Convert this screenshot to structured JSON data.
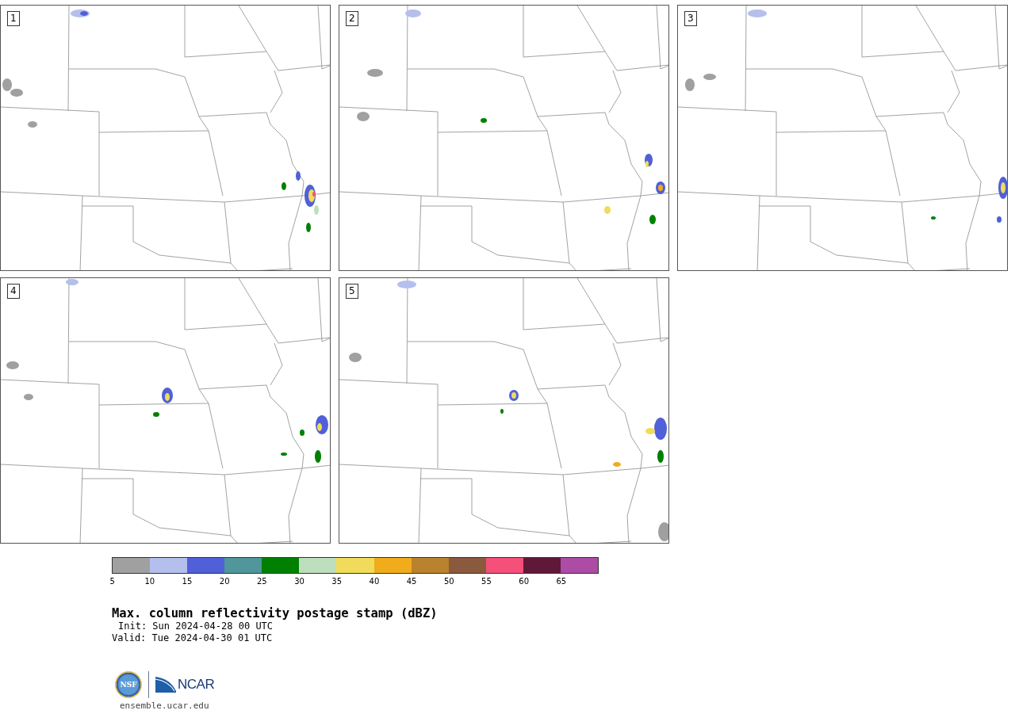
{
  "panels": [
    {
      "label": "1"
    },
    {
      "label": "2"
    },
    {
      "label": "3"
    },
    {
      "label": "4"
    },
    {
      "label": "5"
    }
  ],
  "colorbar": {
    "bins": [
      {
        "color": "#a0a0a0"
      },
      {
        "color": "#b4bfee"
      },
      {
        "color": "#5060d8"
      },
      {
        "color": "#50969b"
      },
      {
        "color": "#008000"
      },
      {
        "color": "#bedfbe"
      },
      {
        "color": "#f0dc5a"
      },
      {
        "color": "#f0ac1a"
      },
      {
        "color": "#b8822e"
      },
      {
        "color": "#8a5a3e"
      },
      {
        "color": "#f4507a"
      },
      {
        "color": "#601838"
      },
      {
        "color": "#ac4ca4"
      }
    ],
    "ticks": [
      "5",
      "10",
      "15",
      "20",
      "25",
      "30",
      "35",
      "40",
      "45",
      "50",
      "55",
      "60",
      "65"
    ]
  },
  "title": "Max. column reflectivity postage stamp (dBZ)",
  "init": "Init: Sun 2024-04-28 00 UTC",
  "valid": "Valid: Tue 2024-04-30 01 UTC",
  "logos": {
    "nsf": "NSF",
    "ncar": "NCAR"
  },
  "url": "ensemble.ucar.edu"
}
